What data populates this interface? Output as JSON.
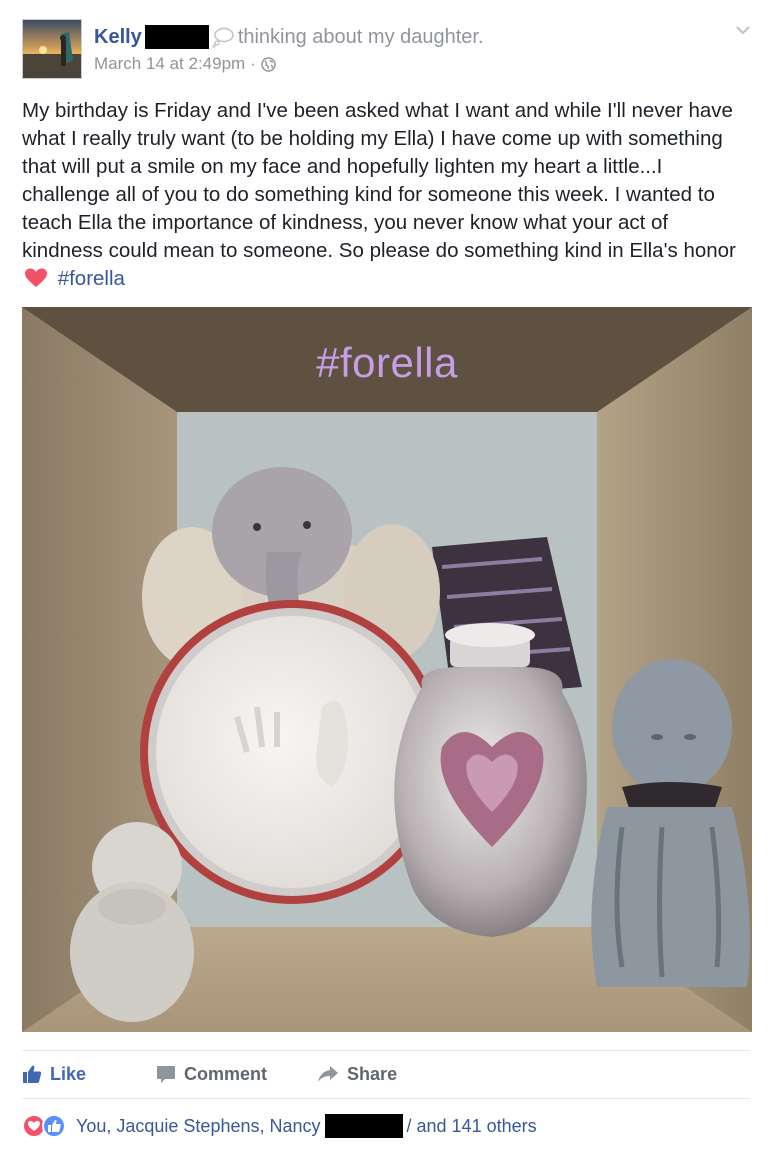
{
  "post": {
    "author": {
      "name": "Kelly",
      "activity": "thinking about my daughter."
    },
    "timestamp": "March 14 at 2:49pm",
    "separator": "·",
    "body_text": "My birthday is Friday and I've been asked what I want and while I'll never have what I really truly want (to be holding my Ella) I have come up with something that will put a smile on my face and hopefully lighten my heart a little...I challenge all of you to do something kind for someone this week. I wanted to teach Ella the importance of kindness, you never know what your act of kindness could mean to someone. So please do something kind in Ella's honor",
    "hashtag": "#forella",
    "photo": {
      "caption": "#forella"
    }
  },
  "actions": {
    "like_label": "Like",
    "comment_label": "Comment",
    "share_label": "Share"
  },
  "reactions": {
    "names_before": "You, Jacquie Stephens, Nancy",
    "names_after": "/ and 141 others"
  },
  "colors": {
    "link_blue": "#365899",
    "like_blue": "#4267b2",
    "meta_gray": "#90949c",
    "caption_purple": "#c69de6",
    "love_red": "#f25268"
  },
  "icons": {
    "thinking": "thought-bubble-icon",
    "privacy": "globe-icon",
    "menu": "chevron-down-icon",
    "heart": "heart-icon",
    "like": "thumbs-up-icon",
    "comment": "comment-icon",
    "share": "share-arrow-icon"
  }
}
